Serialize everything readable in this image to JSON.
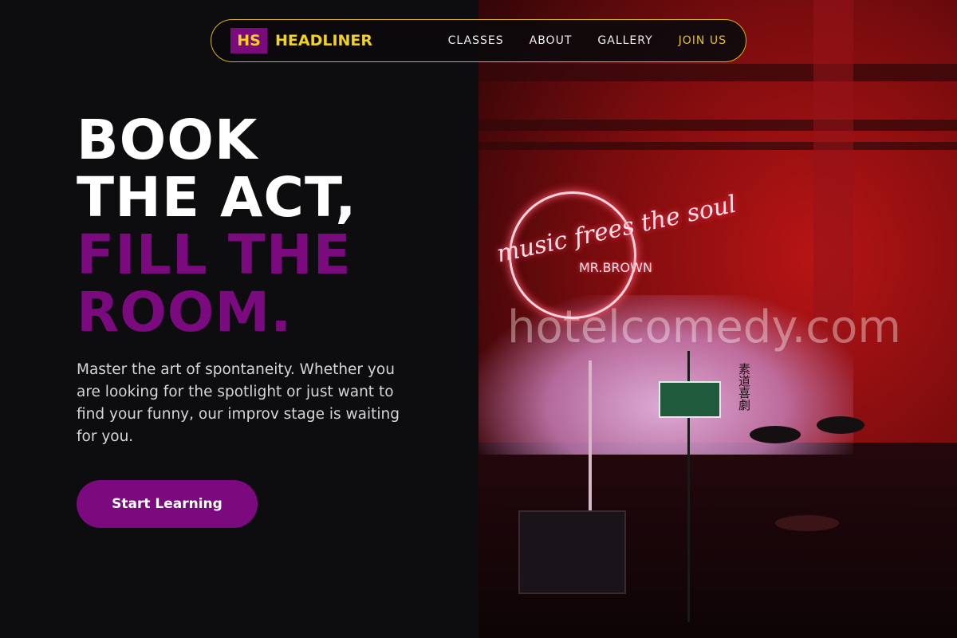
{
  "brand": {
    "mark": "HS",
    "name": "HEADLINER"
  },
  "nav": {
    "links": [
      "CLASSES",
      "ABOUT",
      "GALLERY",
      "JOIN US"
    ]
  },
  "hero": {
    "headline_white": [
      "BOOK",
      "THE ACT,"
    ],
    "headline_purple": [
      "FILL THE",
      "ROOM."
    ],
    "subtitle": "Master the art of spontaneity. Whether you are looking for the spotlight or just want to find your funny, our improv stage is waiting for you.",
    "cta_label": "Start Learning"
  },
  "photo": {
    "neon_script": "music frees the soul",
    "neon_name": "MR.BROWN",
    "watermark": "hotelcomedy.com",
    "sign_text": "素道喜劇"
  },
  "colors": {
    "accent_purple": "#7a0a7d",
    "accent_yellow": "#f2d21c",
    "background": "#0d0c0e"
  }
}
